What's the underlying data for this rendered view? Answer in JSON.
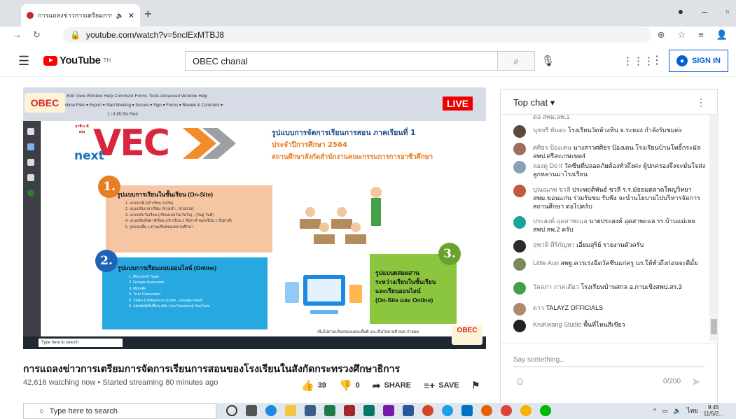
{
  "browser": {
    "tab_title": "การแถลงข่าวการเตรียมการจัดการ",
    "new_tab": "+",
    "url": "youtube.com/watch?v=5nclExMTBJ8"
  },
  "youtube": {
    "logo_text": "YouTube",
    "logo_region": "TH",
    "search_value": "OBEC chanal",
    "sign_in_label": "SIGN IN"
  },
  "video": {
    "live_badge": "LIVE",
    "watermark": "OBEC",
    "watermark_sub": "Channel",
    "acrobat_menu": "File  Edit  View  Window  Help   Comment   Forms   Tools   Advanced   Window   Help",
    "acrobat_toolbar": "Combine Files ▾   Export ▾   Start Meeting ▾   Secure ▾   Sign ▾   Forms ▾   Review & Comment ▾",
    "acrobat_nav": "1 / 8     85.5%     Find",
    "slide": {
      "logo_small": "อาชีวะ ดีเด่น",
      "logo_big": "VEC",
      "logo_next": "next",
      "heading_1": "รูปแบบการจัดการเรียนการสอน ภาคเรียนที่ 1",
      "heading_2": "ประจำปีการศึกษา 2564",
      "heading_3": "สถานศึกษาสังกัดสำนักงานคณะกรรมการการอาชีวศึกษา",
      "section_1_num": "1.",
      "section_1_title": "รูปแบบการเรียนในชั้นเรียน (On-Site)",
      "section_1_items": [
        "1. แบบปกติ (เข้าเรียน 100%)",
        "2. แบบสลับเวลาเรียน (ช่วงเช้า , ช่วงบ่าย)",
        "3. แบบสลับวันเรียน (เรียนแบบวันเว้นวัน) , (วันคู่ วันคี่)",
        "4. แบบสลับสัปดาห์เรียน (เข้าเรียน 1 สัปดาห์ หยุดเรียน 1 สัปดาห์)",
        "5. รูปแบบอื่น ๆ ตามบริบทของสถานศึกษา"
      ],
      "section_2_num": "2.",
      "section_2_title": "รูปแบบการเรียนแบบออนไลน์ (Online)",
      "section_2_items": [
        "1. Microsoft Team",
        "2. Google classroom",
        "3. Moodle",
        "4. True Classroom",
        "5. Video Conference (Zoom , Google meet)",
        "6. แพลตฟอร์มอื่นๆ เช่น Line Facebook YouTube"
      ],
      "section_3_num": "3.",
      "section_3_lines": [
        "รูปแบบผสมผสาน",
        "ระหว่างเรียนในชั้นเรียน",
        "และเรียนออนไลน์",
        "(On-Site และ Online)"
      ],
      "footnote": "เป็นไปตามบริบทของแต่ละพื้นที่ และเป็นไปตามที่ สบค.กำหนด"
    },
    "inner_taskbar_search": "Type here to search"
  },
  "info": {
    "title": "การแถลงข่าวการเตรียมการจัดการเรียนการสอนของโรงเรียนในสังกัดกระทรวงศึกษาธิการ",
    "stats": "42,616 watching now • Started streaming 80 minutes ago",
    "likes": "39",
    "dislikes": "0",
    "share": "SHARE",
    "save": "SAVE"
  },
  "chat": {
    "header": "Top chat",
    "partial_top": "ต่อ สพม.ลพ.1",
    "messages": [
      {
        "author": "นุชจรี ทันตะ",
        "text": "โรงเรียนวัดห้วงหิน จ.ระยอง กำลังรับชมค่ะ",
        "color": "#5d4a3a"
      },
      {
        "author": "ศศิธร ป้องเคน",
        "text": "นางสาวศศิธร ป้องเคน โรงเรียนบ้านโพธิ์กระมัล สพป.ศรีสะเกษเขต4",
        "color": "#a06e5c"
      },
      {
        "author": "ลองดู Do it",
        "text": "วัคซีนที่ปลอดภัยต้องทั่วถึงค่ะ ผู้ปกครองจึงจะมั่นใจส่งลูกหลานมาโรงเรียน",
        "color": "#8aa0b8"
      },
      {
        "author": "ปุณณภพ ชวลี",
        "text": "ประพฤติพันธ์ ชวลี ร.ร.มัธยมตลาดใหญ่วิทยา สพม.ขอนแก่น ร่วมรับชม รับฟัง จะนำนโยบายไปบริหารจัดการสถานศึกษา ต่อไปครับ",
        "color": "#c25a3c"
      },
      {
        "author": "ประสงค์ อุดสาพะแล",
        "text": "นายประสงค์ อุดสาพะแล รร.บ้านแม่เทย สพป.ลพ.2 ครับ",
        "color": "#1aa59a"
      },
      {
        "author": "สุชาติ ศิริกัญหา",
        "text": "เอี่ยมสุริย์ รายงานตัวครับ",
        "color": "#2b2b2b"
      },
      {
        "author": "Little Aun",
        "text": "สพฐ.ควรเร่งฉีดวัคซีนแก่ครู นร.ให้ทั่วถึงก่อนจะดีมั้ย",
        "color": "#7a8a5a"
      },
      {
        "author": "วัลลภา ภาคเดียว",
        "text": "โรงเรียนบ้านสกล อ.กาบเชิงสพป.สร.3",
        "color": "#43a047"
      },
      {
        "author": "ดาว",
        "text": "TALAYZ OFFICIALS",
        "color": "#b08a6a"
      },
      {
        "author": "KruKwang Studio",
        "text": "พื้นที่ไหนสีเขียว",
        "color": "#222222"
      }
    ],
    "say_placeholder": "Say something...",
    "char_count": "0/200"
  },
  "taskbar": {
    "search": "Type here to search",
    "lang": "ไทย",
    "time": "9:45",
    "date": "11/5/2..."
  }
}
